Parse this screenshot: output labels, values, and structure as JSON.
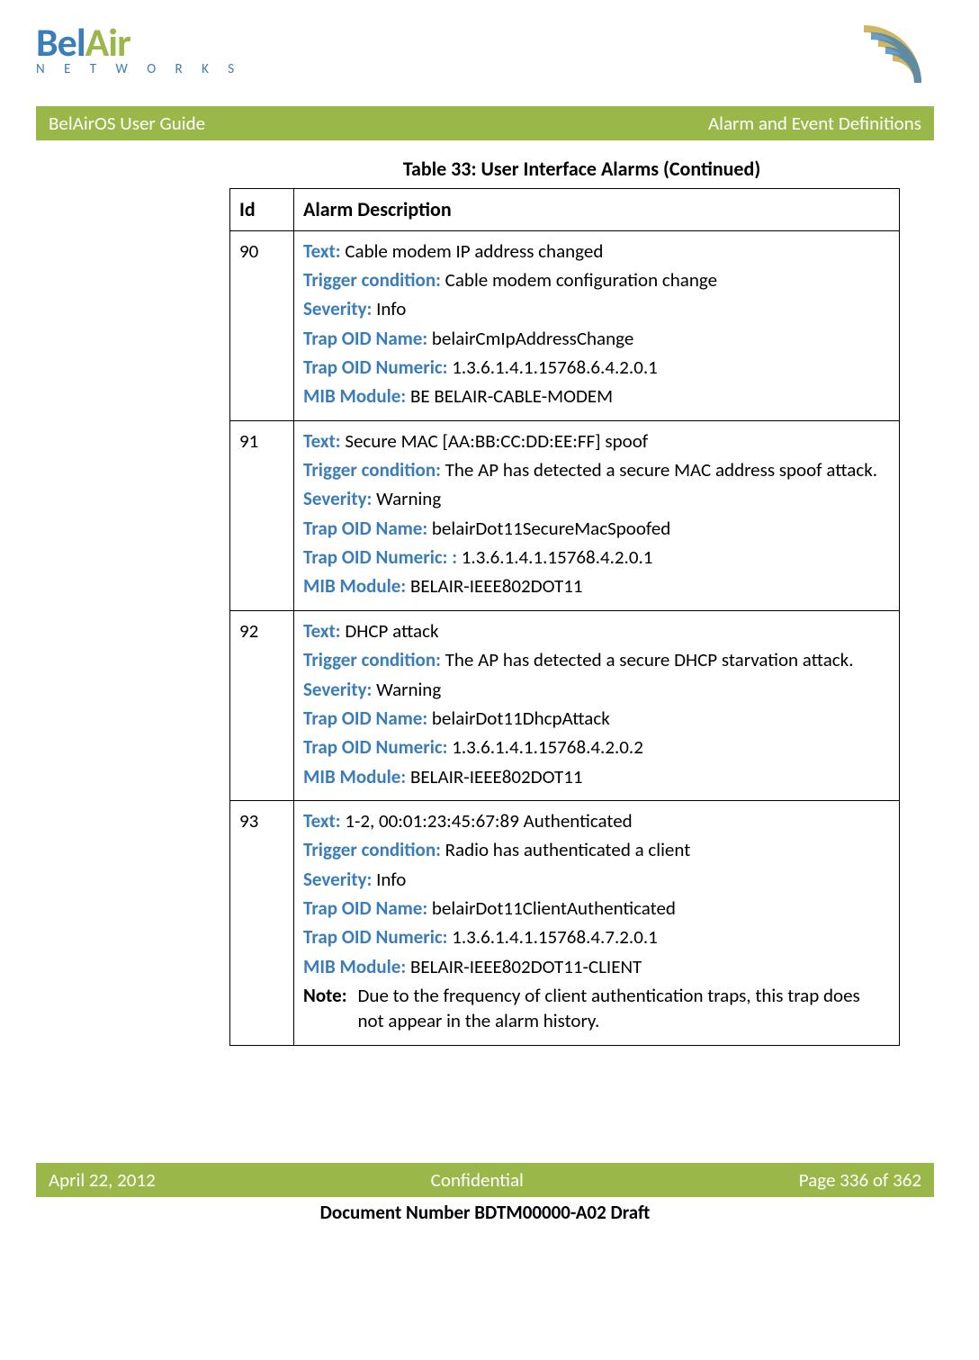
{
  "logo": {
    "left": "Bel",
    "right": "Air",
    "bottom": "N E T W O R K S"
  },
  "bar": {
    "left": "BelAirOS User Guide",
    "right": "Alarm and Event Definitions"
  },
  "caption": "Table 33: User Interface Alarms  (Continued)",
  "headers": {
    "id": "Id",
    "desc": "Alarm Description"
  },
  "labels": {
    "text": "Text:",
    "trigger": "Trigger condition:",
    "severity": "Severity:",
    "trap_name": "Trap OID Name:",
    "trap_num": "Trap OID Numeric:",
    "trap_num_colon": "Trap OID Numeric: :",
    "mib": "MIB Module:",
    "note": "Note:"
  },
  "rows": [
    {
      "id": "90",
      "text": "Cable modem IP address changed",
      "trigger": "Cable modem configuration change",
      "severity": "Info",
      "trap_name": "belairCmIpAddressChange",
      "trap_num": "1.3.6.1.4.1.15768.6.4.2.0.1",
      "mib": "BE BELAIR-CABLE-MODEM"
    },
    {
      "id": "91",
      "text": "Secure MAC [AA:BB:CC:DD:EE:FF] spoof",
      "trigger": "The AP has detected a secure MAC address spoof attack.",
      "severity": "Warning",
      "trap_name": "belairDot11SecureMacSpoofed",
      "trap_num": "1.3.6.1.4.1.15768.4.2.0.1",
      "mib": "BELAIR-IEEE802DOT11",
      "extra_colon": true
    },
    {
      "id": "92",
      "text": "DHCP attack",
      "trigger": "The AP has detected a secure DHCP starvation attack.",
      "severity": "Warning",
      "trap_name": "belairDot11DhcpAttack",
      "trap_num": "1.3.6.1.4.1.15768.4.2.0.2",
      "mib": "BELAIR-IEEE802DOT11"
    },
    {
      "id": "93",
      "text": "1-2, 00:01:23:45:67:89 Authenticated",
      "trigger": "Radio has authenticated a client",
      "severity": "Info",
      "trap_name": "belairDot11ClientAuthenticated",
      "trap_num": "1.3.6.1.4.1.15768.4.7.2.0.1",
      "mib": "BELAIR-IEEE802DOT11-CLIENT",
      "note": "Due to the frequency of client authentication traps, this trap does not appear in the alarm history."
    }
  ],
  "footer": {
    "left": "April 22, 2012",
    "center": "Confidential",
    "right": "Page 336 of 362"
  },
  "docnum": "Document Number BDTM00000-A02 Draft"
}
